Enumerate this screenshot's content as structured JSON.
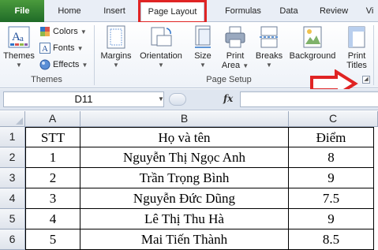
{
  "tabs": [
    {
      "label": "File"
    },
    {
      "label": "Home"
    },
    {
      "label": "Insert"
    },
    {
      "label": "Page Layout"
    },
    {
      "label": "Formulas"
    },
    {
      "label": "Data"
    },
    {
      "label": "Review"
    },
    {
      "label": "Vi"
    }
  ],
  "ribbon": {
    "themes_group": {
      "themes_label": "Themes",
      "colors_label": "Colors",
      "fonts_label": "Fonts",
      "effects_label": "Effects",
      "group_label": "Themes"
    },
    "page_setup_group": {
      "margins_label": "Margins",
      "orientation_label": "Orientation",
      "size_label": "Size",
      "print_area_line1": "Print",
      "print_area_line2": "Area",
      "breaks_label": "Breaks",
      "background_label": "Background",
      "print_titles_line1": "Print",
      "print_titles_line2": "Titles",
      "group_label": "Page Setup"
    }
  },
  "formula_bar": {
    "name_box": "D11",
    "fx_label": "fx",
    "formula": ""
  },
  "sheet": {
    "columns": [
      "A",
      "B",
      "C"
    ],
    "row_numbers": [
      "1",
      "2",
      "3",
      "4",
      "5",
      "6"
    ],
    "rows": [
      [
        "STT",
        "Họ và tên",
        "Điểm"
      ],
      [
        "1",
        "Nguyễn Thị Ngọc Anh",
        "8"
      ],
      [
        "2",
        "Trần Trọng Bình",
        "9"
      ],
      [
        "3",
        "Nguyễn Đức Dũng",
        "7.5"
      ],
      [
        "4",
        "Lê Thị Thu Hà",
        "9"
      ],
      [
        "5",
        "Mai Tiến Thành",
        "8.5"
      ]
    ]
  },
  "colors": {
    "file_tab": "#2e7d32",
    "highlight": "#e02424",
    "arrow": "#e02424"
  }
}
